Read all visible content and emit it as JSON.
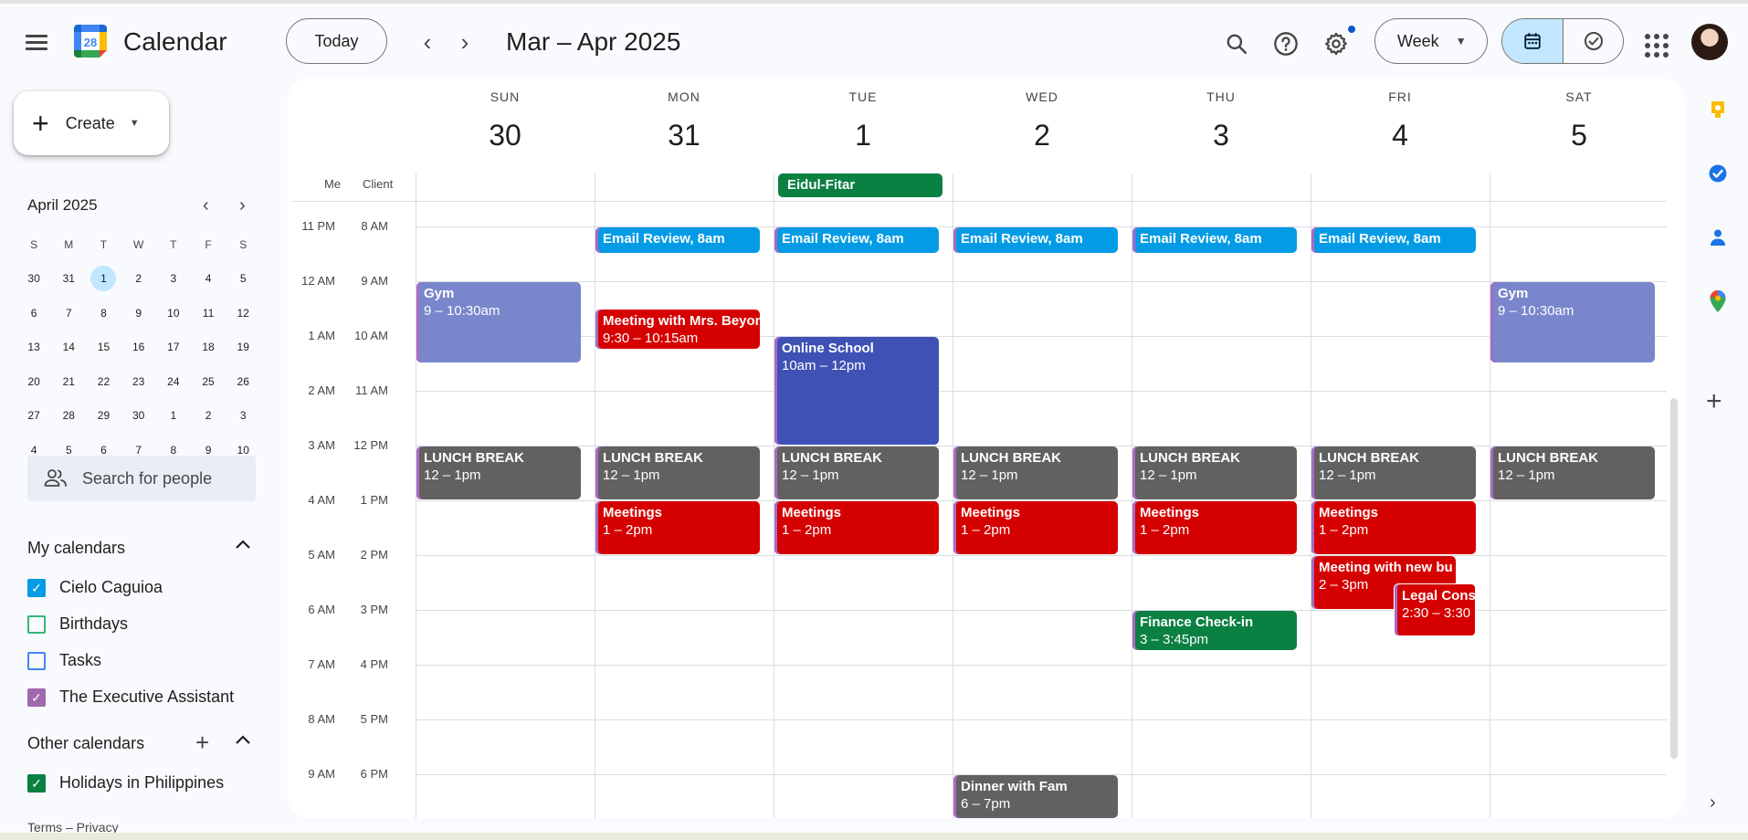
{
  "app": {
    "title": "Calendar",
    "logo_number": "28"
  },
  "toolbar": {
    "today_label": "Today",
    "prev_label": "‹",
    "next_label": "›",
    "range_title": "Mar – Apr 2025",
    "view_label": "Week",
    "icons": [
      "search-icon",
      "help-icon",
      "settings-icon",
      "calendar-view-icon",
      "tasks-view-icon",
      "apps-icon",
      "avatar"
    ]
  },
  "sidebar": {
    "create_label": "Create",
    "mini_calendar": {
      "title": "April 2025",
      "weekdays": [
        "S",
        "M",
        "T",
        "W",
        "T",
        "F",
        "S"
      ],
      "weeks": [
        [
          "30",
          "31",
          "1",
          "2",
          "3",
          "4",
          "5"
        ],
        [
          "6",
          "7",
          "8",
          "9",
          "10",
          "11",
          "12"
        ],
        [
          "13",
          "14",
          "15",
          "16",
          "17",
          "18",
          "19"
        ],
        [
          "20",
          "21",
          "22",
          "23",
          "24",
          "25",
          "26"
        ],
        [
          "27",
          "28",
          "29",
          "30",
          "1",
          "2",
          "3"
        ],
        [
          "4",
          "5",
          "6",
          "7",
          "8",
          "9",
          "10"
        ]
      ],
      "today": "1"
    },
    "search_people_placeholder": "Search for people",
    "my_calendars_title": "My calendars",
    "my_calendars": [
      {
        "label": "Cielo Caguioa",
        "checked": true,
        "color": "#039be5"
      },
      {
        "label": "Birthdays",
        "checked": false,
        "color": "#33b679"
      },
      {
        "label": "Tasks",
        "checked": false,
        "color": "#4285f4"
      },
      {
        "label": "The Executive Assistant",
        "checked": true,
        "color": "#9e69af"
      }
    ],
    "other_calendars_title": "Other calendars",
    "other_calendars": [
      {
        "label": "Holidays in Philippines",
        "checked": true,
        "color": "#0b8043"
      }
    ],
    "footer": "Terms – Privacy"
  },
  "week": {
    "days": [
      {
        "dow": "SUN",
        "num": "30"
      },
      {
        "dow": "MON",
        "num": "31"
      },
      {
        "dow": "TUE",
        "num": "1"
      },
      {
        "dow": "WED",
        "num": "2"
      },
      {
        "dow": "THU",
        "num": "3"
      },
      {
        "dow": "FRI",
        "num": "4"
      },
      {
        "dow": "SAT",
        "num": "5"
      }
    ],
    "timezones": [
      "Me",
      "Client"
    ],
    "hours": [
      {
        "me": "11 PM",
        "client": "8 AM"
      },
      {
        "me": "12 AM",
        "client": "9 AM"
      },
      {
        "me": "1 AM",
        "client": "10 AM"
      },
      {
        "me": "2 AM",
        "client": "11 AM"
      },
      {
        "me": "3 AM",
        "client": "12 PM"
      },
      {
        "me": "4 AM",
        "client": "1 PM"
      },
      {
        "me": "5 AM",
        "client": "2 PM"
      },
      {
        "me": "6 AM",
        "client": "3 PM"
      },
      {
        "me": "7 AM",
        "client": "4 PM"
      },
      {
        "me": "8 AM",
        "client": "5 PM"
      },
      {
        "me": "9 AM",
        "client": "6 PM"
      }
    ],
    "all_day_event": {
      "title": "Eidul-Fitar",
      "day": 2,
      "color": "#0b8043"
    },
    "colors": {
      "email": "#039be5",
      "gym": "#7986cb",
      "lunch": "#616161",
      "meeting": "#d50000",
      "school": "#3f51b5",
      "finance": "#0b8043",
      "dinner": "#616161"
    },
    "events": [
      {
        "day": 1,
        "title": "Email Review, 8am",
        "time": "",
        "start": 8.0,
        "end": 8.5,
        "color": "#039be5"
      },
      {
        "day": 2,
        "title": "Email Review, 8am",
        "time": "",
        "start": 8.0,
        "end": 8.5,
        "color": "#039be5"
      },
      {
        "day": 3,
        "title": "Email Review, 8am",
        "time": "",
        "start": 8.0,
        "end": 8.5,
        "color": "#039be5"
      },
      {
        "day": 4,
        "title": "Email Review, 8am",
        "time": "",
        "start": 8.0,
        "end": 8.5,
        "color": "#039be5"
      },
      {
        "day": 5,
        "title": "Email Review, 8am",
        "time": "",
        "start": 8.0,
        "end": 8.5,
        "color": "#039be5"
      },
      {
        "day": 0,
        "title": "Gym",
        "time": "9 – 10:30am",
        "start": 9.0,
        "end": 10.5,
        "color": "#7986cb"
      },
      {
        "day": 6,
        "title": "Gym",
        "time": "9 – 10:30am",
        "start": 9.0,
        "end": 10.5,
        "color": "#7986cb"
      },
      {
        "day": 1,
        "title": "Meeting with Mrs. Beyonce",
        "time": "9:30 – 10:15am",
        "start": 9.5,
        "end": 10.25,
        "color": "#d50000"
      },
      {
        "day": 2,
        "title": "Online School",
        "time": "10am – 12pm",
        "start": 10.0,
        "end": 12.0,
        "color": "#3f51b5"
      },
      {
        "day": 0,
        "title": "LUNCH BREAK",
        "time": "12 – 1pm",
        "start": 12.0,
        "end": 13.0,
        "color": "#616161"
      },
      {
        "day": 1,
        "title": "LUNCH BREAK",
        "time": "12 – 1pm",
        "start": 12.0,
        "end": 13.0,
        "color": "#616161"
      },
      {
        "day": 2,
        "title": "LUNCH BREAK",
        "time": "12 – 1pm",
        "start": 12.0,
        "end": 13.0,
        "color": "#616161"
      },
      {
        "day": 3,
        "title": "LUNCH BREAK",
        "time": "12 – 1pm",
        "start": 12.0,
        "end": 13.0,
        "color": "#616161"
      },
      {
        "day": 4,
        "title": "LUNCH BREAK",
        "time": "12 – 1pm",
        "start": 12.0,
        "end": 13.0,
        "color": "#616161"
      },
      {
        "day": 5,
        "title": "LUNCH BREAK",
        "time": "12 – 1pm",
        "start": 12.0,
        "end": 13.0,
        "color": "#616161"
      },
      {
        "day": 6,
        "title": "LUNCH BREAK",
        "time": "12 – 1pm",
        "start": 12.0,
        "end": 13.0,
        "color": "#616161"
      },
      {
        "day": 1,
        "title": "Meetings",
        "time": "1 – 2pm",
        "start": 13.0,
        "end": 14.0,
        "color": "#d50000"
      },
      {
        "day": 2,
        "title": "Meetings",
        "time": "1 – 2pm",
        "start": 13.0,
        "end": 14.0,
        "color": "#d50000"
      },
      {
        "day": 3,
        "title": "Meetings",
        "time": "1 – 2pm",
        "start": 13.0,
        "end": 14.0,
        "color": "#d50000"
      },
      {
        "day": 4,
        "title": "Meetings",
        "time": "1 – 2pm",
        "start": 13.0,
        "end": 14.0,
        "color": "#d50000"
      },
      {
        "day": 5,
        "title": "Meetings",
        "time": "1 – 2pm",
        "start": 13.0,
        "end": 14.0,
        "color": "#d50000"
      },
      {
        "day": 5,
        "title": "Meeting with new bu",
        "time": "2 – 3pm",
        "start": 14.0,
        "end": 15.0,
        "color": "#d50000",
        "slot": "left"
      },
      {
        "day": 5,
        "title": "Legal Cons",
        "time": "2:30 – 3:30",
        "start": 14.5,
        "end": 15.5,
        "color": "#d50000",
        "slot": "right"
      },
      {
        "day": 4,
        "title": "Finance Check-in",
        "time": "3 – 3:45pm",
        "start": 15.0,
        "end": 15.75,
        "color": "#0b8043"
      },
      {
        "day": 3,
        "title": "Dinner with Fam",
        "time": "6 – 7pm",
        "start": 18.0,
        "end": 19.0,
        "color": "#616161"
      }
    ]
  },
  "right_rail": [
    "keep-icon",
    "tasks-icon",
    "contacts-icon",
    "maps-icon",
    "add-addon-icon",
    "expand-icon"
  ]
}
